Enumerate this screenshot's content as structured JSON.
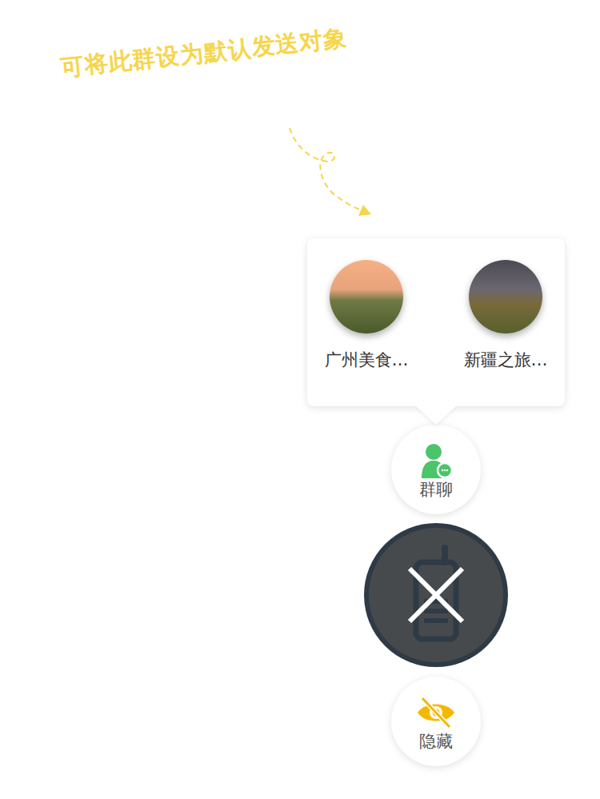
{
  "annotation": {
    "text": "可将此群设为默认发送对象"
  },
  "groups": [
    {
      "name": "广州美食…"
    },
    {
      "name": "新疆之旅…"
    }
  ],
  "buttons": [
    {
      "label": "群聊"
    },
    {
      "label": "隐藏"
    }
  ]
}
